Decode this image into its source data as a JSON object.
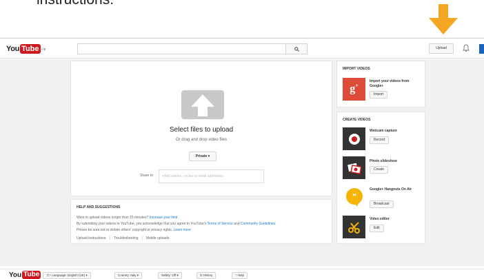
{
  "instruction": {
    "text": "instructions."
  },
  "masthead": {
    "logo_you": "You",
    "logo_tube": "Tube",
    "search_placeholder": "",
    "upload_label": "Upload"
  },
  "upload": {
    "title": "Select files to upload",
    "subtitle": "Or drag and drop video files",
    "privacy": "Private ▾",
    "share_label": "Share to:",
    "share_placeholder": "+Add names, circles or email addresses"
  },
  "help": {
    "title": "HELP AND SUGGESTIONS",
    "line1_text": "Want to upload videos longer than 15 minutes? ",
    "line1_link": "Increase your limit",
    "line2_text": "By submitting your videos to YouTube, you acknowledge that you agree to YouTube's ",
    "line2_link1": "Terms of Service",
    "line2_and": " and ",
    "line2_link2": "Community Guidelines",
    "line2_end": ".",
    "line3_text": "Please be sure not to violate others' copyright or privacy rights. ",
    "line3_link": "Learn more",
    "links": [
      "Upload instructions",
      "Troubleshooting",
      "Mobile uploads"
    ]
  },
  "import": {
    "title": "IMPORT VIDEOS",
    "item_label": "Import your videos from Google+",
    "button": "Import"
  },
  "create": {
    "title": "CREATE VIDEOS",
    "items": [
      {
        "label": "Webcam capture",
        "button": "Record",
        "icon": "webcam-icon",
        "color": "#333333"
      },
      {
        "label": "Photo slideshow",
        "button": "Create",
        "icon": "photo-slideshow-icon",
        "color": "#333333"
      },
      {
        "label": "Google+ Hangouts On Air",
        "button": "Broadcast",
        "icon": "hangouts-icon",
        "color": "#f5b400"
      },
      {
        "label": "Video editor",
        "button": "Edit",
        "icon": "video-editor-icon",
        "color": "#333333"
      }
    ]
  },
  "footer": {
    "logo_you": "You",
    "logo_tube": "Tube",
    "language": "Language: English (UK) ▾",
    "country": "Country: Italy ▾",
    "safety": "Safety: Off ▾",
    "history": "History",
    "help": "Help"
  },
  "colors": {
    "brand_red": "#cc181e",
    "arrow": "#f5a623",
    "link": "#167ac6",
    "gplus_red": "#dd4b39"
  }
}
